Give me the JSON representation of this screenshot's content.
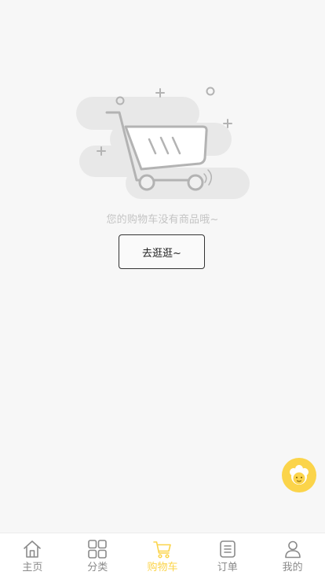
{
  "empty_state": {
    "message": "您的购物车没有商品哦~",
    "button_label": "去逛逛~"
  },
  "tabbar": {
    "items": [
      {
        "label": "主页",
        "icon": "home-icon",
        "active": false
      },
      {
        "label": "分类",
        "icon": "category-grid-icon",
        "active": false
      },
      {
        "label": "购物车",
        "icon": "cart-icon",
        "active": true
      },
      {
        "label": "订单",
        "icon": "order-list-icon",
        "active": false
      },
      {
        "label": "我的",
        "icon": "user-icon",
        "active": false
      }
    ]
  },
  "colors": {
    "accent": "#fbd44a",
    "inactive": "#8a8a8a",
    "background": "#f7f7f7"
  }
}
